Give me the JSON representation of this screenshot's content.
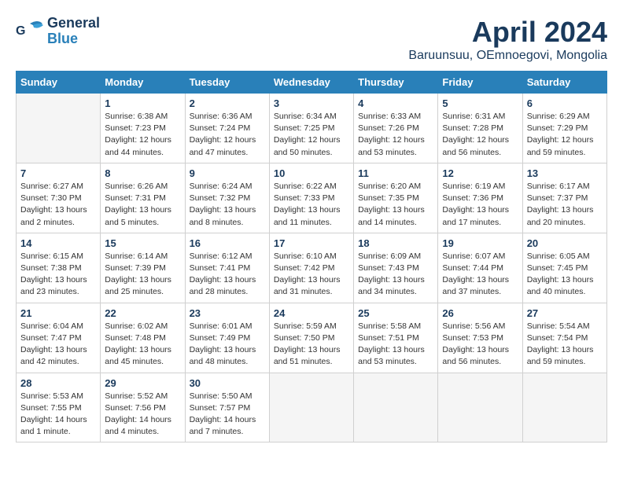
{
  "header": {
    "logo_line1": "General",
    "logo_line2": "Blue",
    "title": "April 2024",
    "subtitle": "Baruunsuu, OEmnoegovi, Mongolia"
  },
  "calendar": {
    "days_of_week": [
      "Sunday",
      "Monday",
      "Tuesday",
      "Wednesday",
      "Thursday",
      "Friday",
      "Saturday"
    ],
    "weeks": [
      [
        {
          "day": "",
          "info": ""
        },
        {
          "day": "1",
          "info": "Sunrise: 6:38 AM\nSunset: 7:23 PM\nDaylight: 12 hours\nand 44 minutes."
        },
        {
          "day": "2",
          "info": "Sunrise: 6:36 AM\nSunset: 7:24 PM\nDaylight: 12 hours\nand 47 minutes."
        },
        {
          "day": "3",
          "info": "Sunrise: 6:34 AM\nSunset: 7:25 PM\nDaylight: 12 hours\nand 50 minutes."
        },
        {
          "day": "4",
          "info": "Sunrise: 6:33 AM\nSunset: 7:26 PM\nDaylight: 12 hours\nand 53 minutes."
        },
        {
          "day": "5",
          "info": "Sunrise: 6:31 AM\nSunset: 7:28 PM\nDaylight: 12 hours\nand 56 minutes."
        },
        {
          "day": "6",
          "info": "Sunrise: 6:29 AM\nSunset: 7:29 PM\nDaylight: 12 hours\nand 59 minutes."
        }
      ],
      [
        {
          "day": "7",
          "info": "Sunrise: 6:27 AM\nSunset: 7:30 PM\nDaylight: 13 hours\nand 2 minutes."
        },
        {
          "day": "8",
          "info": "Sunrise: 6:26 AM\nSunset: 7:31 PM\nDaylight: 13 hours\nand 5 minutes."
        },
        {
          "day": "9",
          "info": "Sunrise: 6:24 AM\nSunset: 7:32 PM\nDaylight: 13 hours\nand 8 minutes."
        },
        {
          "day": "10",
          "info": "Sunrise: 6:22 AM\nSunset: 7:33 PM\nDaylight: 13 hours\nand 11 minutes."
        },
        {
          "day": "11",
          "info": "Sunrise: 6:20 AM\nSunset: 7:35 PM\nDaylight: 13 hours\nand 14 minutes."
        },
        {
          "day": "12",
          "info": "Sunrise: 6:19 AM\nSunset: 7:36 PM\nDaylight: 13 hours\nand 17 minutes."
        },
        {
          "day": "13",
          "info": "Sunrise: 6:17 AM\nSunset: 7:37 PM\nDaylight: 13 hours\nand 20 minutes."
        }
      ],
      [
        {
          "day": "14",
          "info": "Sunrise: 6:15 AM\nSunset: 7:38 PM\nDaylight: 13 hours\nand 23 minutes."
        },
        {
          "day": "15",
          "info": "Sunrise: 6:14 AM\nSunset: 7:39 PM\nDaylight: 13 hours\nand 25 minutes."
        },
        {
          "day": "16",
          "info": "Sunrise: 6:12 AM\nSunset: 7:41 PM\nDaylight: 13 hours\nand 28 minutes."
        },
        {
          "day": "17",
          "info": "Sunrise: 6:10 AM\nSunset: 7:42 PM\nDaylight: 13 hours\nand 31 minutes."
        },
        {
          "day": "18",
          "info": "Sunrise: 6:09 AM\nSunset: 7:43 PM\nDaylight: 13 hours\nand 34 minutes."
        },
        {
          "day": "19",
          "info": "Sunrise: 6:07 AM\nSunset: 7:44 PM\nDaylight: 13 hours\nand 37 minutes."
        },
        {
          "day": "20",
          "info": "Sunrise: 6:05 AM\nSunset: 7:45 PM\nDaylight: 13 hours\nand 40 minutes."
        }
      ],
      [
        {
          "day": "21",
          "info": "Sunrise: 6:04 AM\nSunset: 7:47 PM\nDaylight: 13 hours\nand 42 minutes."
        },
        {
          "day": "22",
          "info": "Sunrise: 6:02 AM\nSunset: 7:48 PM\nDaylight: 13 hours\nand 45 minutes."
        },
        {
          "day": "23",
          "info": "Sunrise: 6:01 AM\nSunset: 7:49 PM\nDaylight: 13 hours\nand 48 minutes."
        },
        {
          "day": "24",
          "info": "Sunrise: 5:59 AM\nSunset: 7:50 PM\nDaylight: 13 hours\nand 51 minutes."
        },
        {
          "day": "25",
          "info": "Sunrise: 5:58 AM\nSunset: 7:51 PM\nDaylight: 13 hours\nand 53 minutes."
        },
        {
          "day": "26",
          "info": "Sunrise: 5:56 AM\nSunset: 7:53 PM\nDaylight: 13 hours\nand 56 minutes."
        },
        {
          "day": "27",
          "info": "Sunrise: 5:54 AM\nSunset: 7:54 PM\nDaylight: 13 hours\nand 59 minutes."
        }
      ],
      [
        {
          "day": "28",
          "info": "Sunrise: 5:53 AM\nSunset: 7:55 PM\nDaylight: 14 hours\nand 1 minute."
        },
        {
          "day": "29",
          "info": "Sunrise: 5:52 AM\nSunset: 7:56 PM\nDaylight: 14 hours\nand 4 minutes."
        },
        {
          "day": "30",
          "info": "Sunrise: 5:50 AM\nSunset: 7:57 PM\nDaylight: 14 hours\nand 7 minutes."
        },
        {
          "day": "",
          "info": ""
        },
        {
          "day": "",
          "info": ""
        },
        {
          "day": "",
          "info": ""
        },
        {
          "day": "",
          "info": ""
        }
      ]
    ]
  }
}
